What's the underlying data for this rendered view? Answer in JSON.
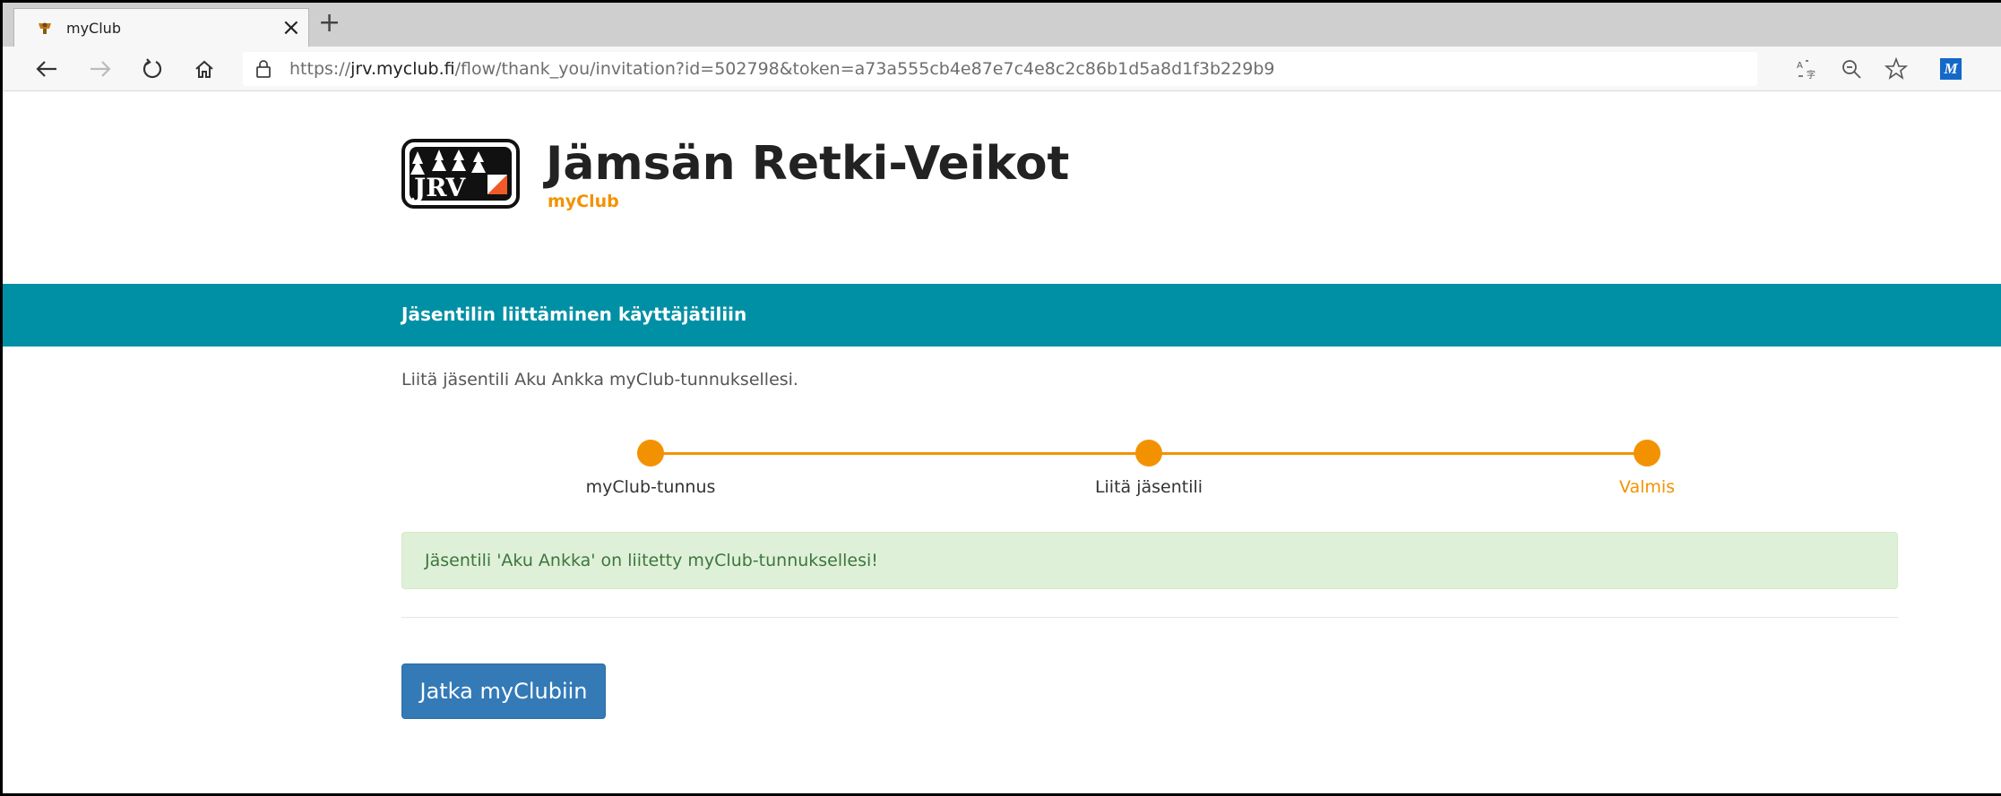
{
  "browser": {
    "tab_title": "myClub",
    "tab_close": "×",
    "new_tab": "+",
    "url_prefix": "https://",
    "url_host": "jrv.myclub.fi",
    "url_path": "/flow/thank_you/invitation?id=502798&token=a73a555cb4e87e7c4e8c2c86b1d5a8d1f3b229b9",
    "icons": [
      "back-icon",
      "forward-icon",
      "refresh-icon",
      "home-icon",
      "lock-icon",
      "translate-icon",
      "zoom-icon",
      "favorite-star-icon",
      "extension-m-icon"
    ],
    "extension_label": "M"
  },
  "header": {
    "club_name": "Jämsän Retki-Veikot",
    "app_name": "myClub",
    "logo_text": "JRV"
  },
  "banner": {
    "title": "Jäsentilin liittäminen käyttäjätiliin"
  },
  "main": {
    "intro": "Liitä jäsentili Aku Ankka myClub-tunnuksellesi.",
    "steps": [
      {
        "label": "myClub-tunnus",
        "active": false
      },
      {
        "label": "Liitä jäsentili",
        "active": false
      },
      {
        "label": "Valmis",
        "active": true
      }
    ],
    "success_message": "Jäsentili 'Aku Ankka' on liitetty myClub-tunnuksellesi!",
    "continue_button": "Jatka myClubiin"
  },
  "colors": {
    "accent_orange": "#f39200",
    "banner_teal": "#0090a5",
    "button_blue": "#337ab7",
    "success_bg": "#dff0d8",
    "success_text": "#3c763d"
  }
}
